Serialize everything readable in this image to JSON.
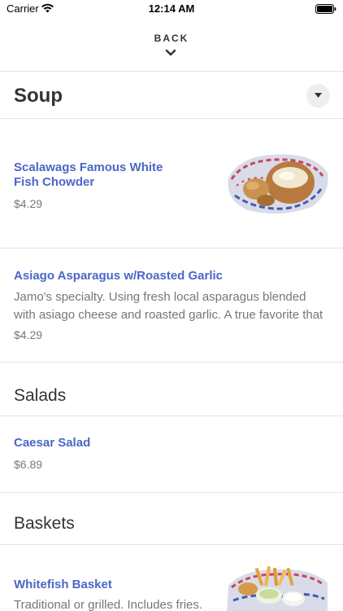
{
  "status_bar": {
    "carrier": "Carrier",
    "time": "12:14 AM"
  },
  "nav": {
    "back_label": "BACK"
  },
  "sections": {
    "soup": {
      "title": "Soup",
      "items": [
        {
          "name_line1": "Scalawags Famous White",
          "name_line2": "Fish Chowder",
          "price": "$4.29"
        },
        {
          "name": "Asiago Asparagus w/Roasted Garlic",
          "desc_line1": "Jamo's specialty.  Using fresh local asparagus blended",
          "desc_line2": "with asiago cheese and roasted garlic.  A true favorite that",
          "price": "$4.29"
        }
      ]
    },
    "salads": {
      "title": "Salads",
      "items": [
        {
          "name": "Caesar Salad",
          "price": "$6.89"
        }
      ]
    },
    "baskets": {
      "title": "Baskets",
      "items": [
        {
          "name": "Whitefish Basket",
          "desc_line1": "Traditional or grilled. Includes fries."
        }
      ]
    }
  },
  "colors": {
    "item_name": "#4a67c5",
    "divider": "#e3e3e3",
    "muted_text": "#777777"
  },
  "icons": [
    "wifi-icon",
    "battery-icon",
    "chevron-down-icon",
    "caret-down-icon",
    "chowder-image",
    "basket-image"
  ]
}
